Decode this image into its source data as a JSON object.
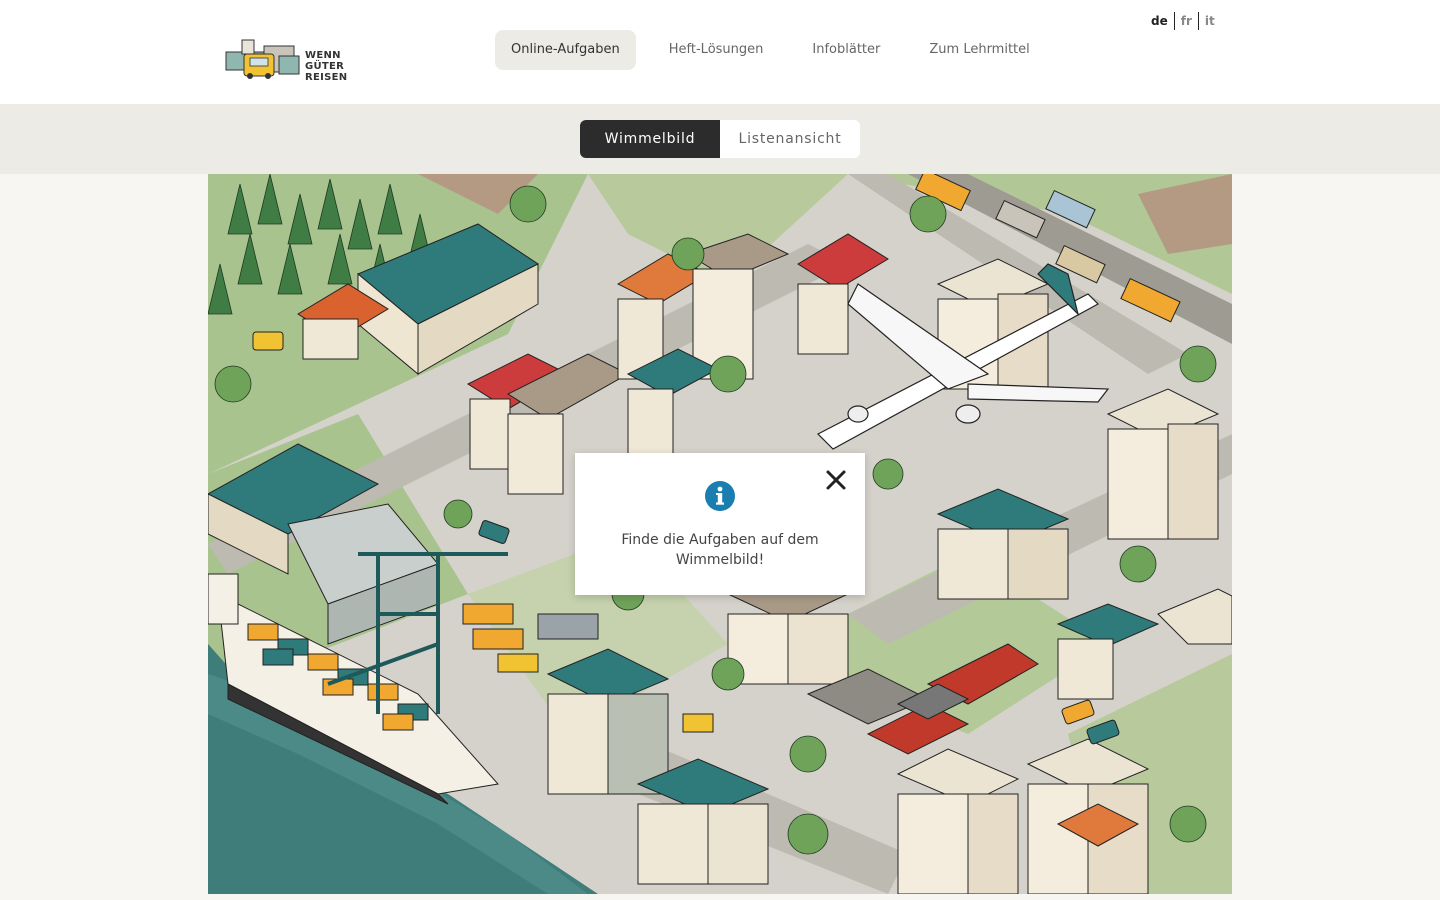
{
  "logo": {
    "line1": "WENN",
    "line2": "GÜTER REISEN"
  },
  "nav": [
    {
      "label": "Online-Aufgaben",
      "active": true
    },
    {
      "label": "Heft-Lösungen",
      "active": false
    },
    {
      "label": "Infoblätter",
      "active": false
    },
    {
      "label": "Zum Lehrmittel",
      "active": false
    }
  ],
  "languages": [
    "de",
    "fr",
    "it"
  ],
  "view_toggle": {
    "active": "Wimmelbild",
    "inactive": "Listenansicht"
  },
  "popup": {
    "message": "Finde die Aufgaben auf dem Wimmelbild!",
    "icon": "info-icon",
    "close_icon": "close-icon"
  },
  "colors": {
    "accent_teal": "#2f7a7a",
    "info_blue": "#1a7fb0",
    "water": "#3f7d7a",
    "toggle_active": "#2c2c2c"
  }
}
